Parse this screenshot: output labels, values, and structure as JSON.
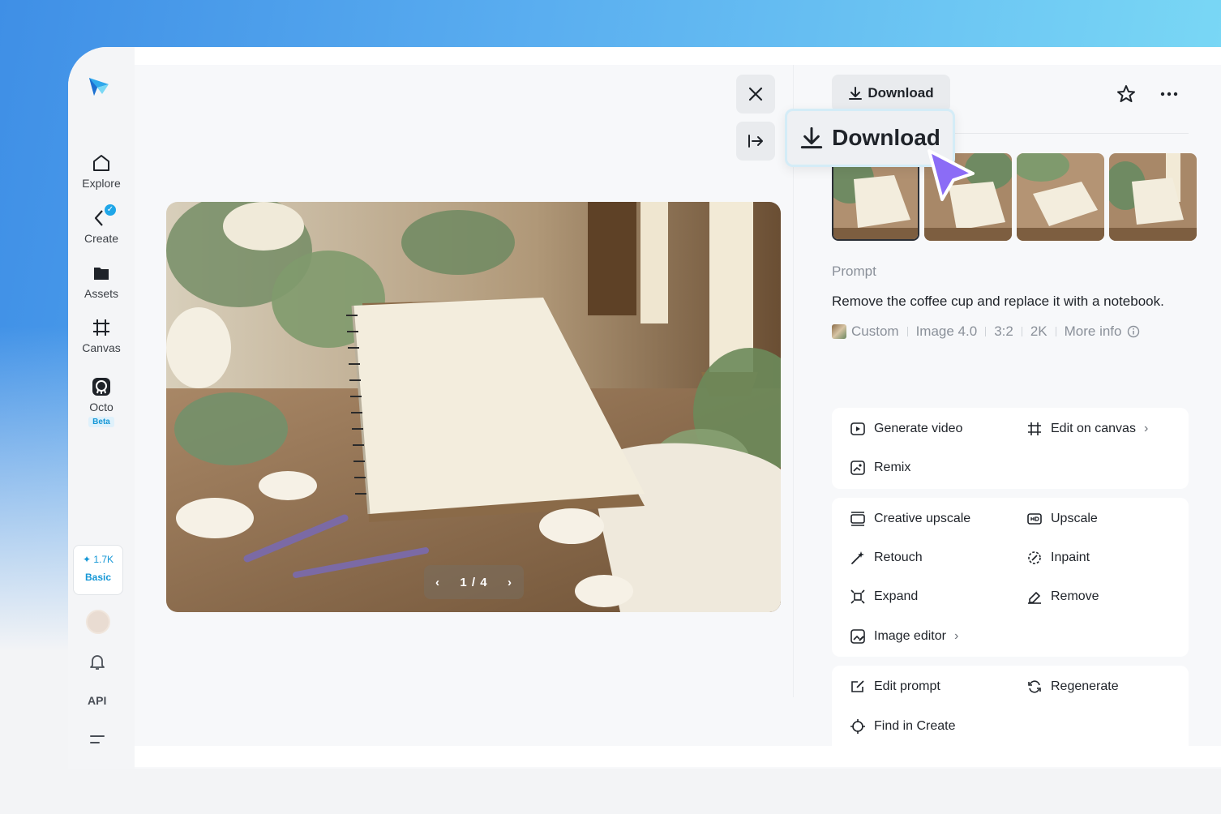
{
  "sidebar": {
    "items": [
      {
        "label": "Explore",
        "icon": "home-icon"
      },
      {
        "label": "Create",
        "icon": "create-icon"
      },
      {
        "label": "Assets",
        "icon": "folder-icon"
      },
      {
        "label": "Canvas",
        "icon": "canvas-icon"
      },
      {
        "label": "Octo",
        "icon": "octo-icon",
        "badge": "Beta"
      }
    ],
    "credits": "1.7K",
    "plan": "Basic",
    "api_label": "API"
  },
  "viewer": {
    "pager": {
      "current": "1",
      "total": "4",
      "separator": "/"
    }
  },
  "panel": {
    "download_label": "Download",
    "download_zoom_label": "Download",
    "prompt_heading": "Prompt",
    "prompt_text": "Remove the coffee cup and replace it with a notebook.",
    "meta": {
      "model_style": "Custom",
      "model": "Image 4.0",
      "ratio": "3:2",
      "resolution": "2K",
      "more_info": "More info"
    },
    "thumbnails_count": 4,
    "selected_thumbnail": 1,
    "actions_group1": {
      "generate_video": "Generate video",
      "edit_on_canvas": "Edit on canvas",
      "remix": "Remix"
    },
    "actions_group2": {
      "creative_upscale": "Creative upscale",
      "upscale": "Upscale",
      "retouch": "Retouch",
      "inpaint": "Inpaint",
      "expand": "Expand",
      "remove": "Remove",
      "image_editor": "Image editor"
    },
    "actions_group3": {
      "edit_prompt": "Edit prompt",
      "regenerate": "Regenerate",
      "find_in_create": "Find in Create"
    }
  },
  "colors": {
    "accent": "#1597d6",
    "cursor": "#8b6cf6",
    "gradient_start": "#3f8fe6",
    "gradient_end": "#7fdff6"
  }
}
